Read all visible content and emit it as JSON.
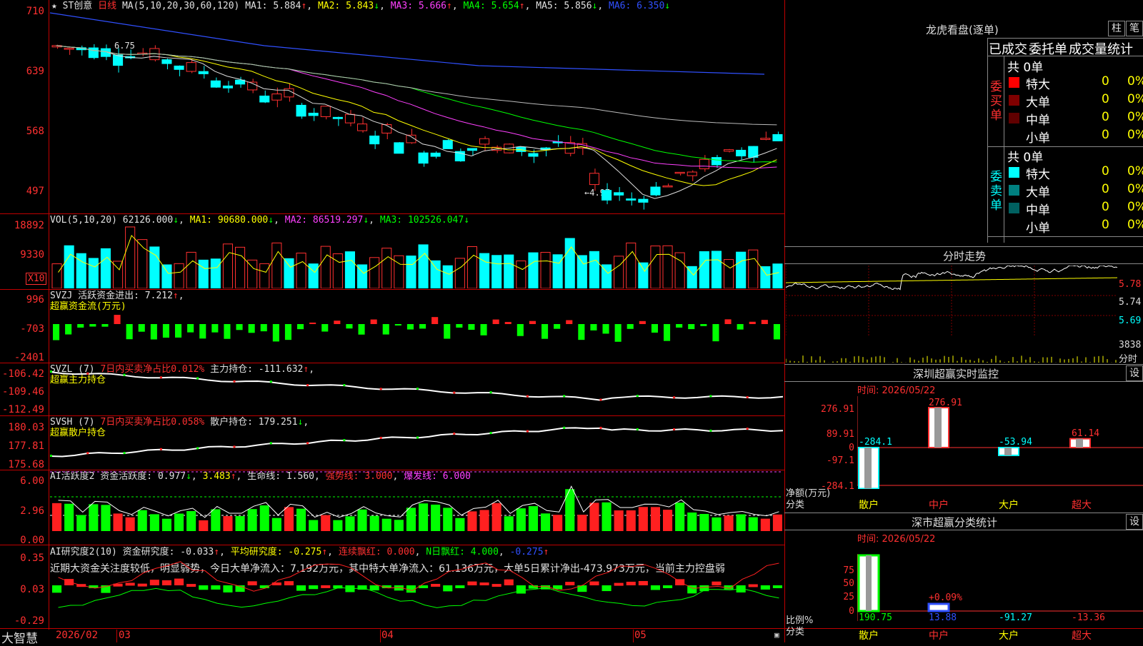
{
  "main_chart": {
    "star": "★",
    "name": "ST创意",
    "period": "日线",
    "ma_label": "MA(5,10,20,30,60,120)",
    "ma": [
      {
        "label": "MA1:",
        "value": "5.884",
        "arrow": "↑",
        "color": "#e0e0e0"
      },
      {
        "label": "MA2:",
        "value": "5.843",
        "arrow": "↓",
        "color": "#ffff00"
      },
      {
        "label": "MA3:",
        "value": "5.666",
        "arrow": "↑",
        "color": "#ff40ff"
      },
      {
        "label": "MA4:",
        "value": "5.654",
        "arrow": "↑",
        "color": "#00ff00"
      },
      {
        "label": "MA5:",
        "value": "5.856",
        "arrow": "↓",
        "color": "#e0e0e0"
      },
      {
        "label": "MA6:",
        "value": "6.350",
        "arrow": "↓",
        "color": "#3050ff"
      }
    ],
    "y_ticks": [
      "710",
      "639",
      "568",
      "497"
    ],
    "high_label": "6.75",
    "low_label": "←4.97"
  },
  "vol": {
    "label": "VOL(5,10,20)",
    "value": "62126.000",
    "ma1": "MA1: 90680.000",
    "ma2": "MA2: 86519.297",
    "ma3": "MA3: 102526.047",
    "y_ticks": [
      "18892",
      "9330"
    ],
    "unit": "X10"
  },
  "svzj": {
    "line1": "SVZJ  活跃资金进出: 7.212",
    "line2": "超赢资金流(万元)",
    "y_ticks": [
      "996",
      "-703",
      "-2401"
    ]
  },
  "svzl": {
    "pre": "SVZL (7)",
    "mid": "7日内买卖净占比0.012%",
    "post": "主力持仓: -111.632",
    "line2": "超赢主力持仓",
    "y_ticks": [
      "-106.42",
      "-109.46",
      "-112.49"
    ]
  },
  "svsh": {
    "pre": "SVSH (7)",
    "mid": "7日内买卖净占比0.058%",
    "post": "散户持仓: 179.251",
    "line2": "超赢散户持仓",
    "y_ticks": [
      "180.03",
      "177.81",
      "175.68"
    ]
  },
  "ai_active": {
    "pre": "AI活跃度2 资金活跃度: 0.977",
    "v2": "3.483",
    "v3": "生命线: 1.560",
    "v4": "强势线: 3.000",
    "v5": "爆发线: 6.000",
    "y_ticks": [
      "6.00",
      "2.96",
      "0.00"
    ]
  },
  "ai_research": {
    "pre": "AI研究度2(10) 资金研究度: -0.033",
    "v2": "平均研究度: -0.275",
    "v3": "连续飘红: 0.000",
    "v4": "N日飘红: 4.000",
    "v5": "-0.275",
    "comment": "近期大资金关注度较低，明显弱势，今日大单净流入：7.192万元，其中特大单净流入：61.136万元，大单5日累计净出-473.973万元，当前主力控盘弱",
    "y_ticks": [
      "0.35",
      "0.03",
      "-0.29"
    ]
  },
  "bottom_bar": {
    "brand": "大智慧",
    "dates": [
      "2026/02",
      "03",
      "04",
      "05"
    ]
  },
  "right": {
    "lhb_title": "龙虎看盘(逐单)",
    "btn_zhu": "柱",
    "btn_bi": "笔",
    "tabs": [
      "已成交",
      "委托单",
      "成交量统计"
    ],
    "buy": {
      "side_label": "委买单",
      "total": "共 0单",
      "rows": [
        {
          "name": "特大",
          "count": "0",
          "pct": "0%",
          "color": "#ff0000"
        },
        {
          "name": "大单",
          "count": "0",
          "pct": "0%",
          "color": "#800000"
        },
        {
          "name": "中单",
          "count": "0",
          "pct": "0%",
          "color": "#600000"
        },
        {
          "name": "小单",
          "count": "0",
          "pct": "0%",
          "color": "#000000"
        }
      ]
    },
    "sell": {
      "side_label": "委卖单",
      "total": "共 0单",
      "rows": [
        {
          "name": "特大",
          "count": "0",
          "pct": "0%",
          "color": "#00ffff"
        },
        {
          "name": "大单",
          "count": "0",
          "pct": "0%",
          "color": "#008080"
        },
        {
          "name": "中单",
          "count": "0",
          "pct": "0%",
          "color": "#006060"
        },
        {
          "name": "小单",
          "count": "0",
          "pct": "0%",
          "color": "#000000"
        }
      ]
    },
    "intraday_title": "分时走势",
    "intraday_ticks": [
      "5.78",
      "5.74",
      "5.69",
      "3838",
      "分时"
    ],
    "sz_title": "深圳超赢实时监控",
    "sz_time": "时间: 2026/05/22",
    "set": "设",
    "sz_yticks": [
      "276.91",
      "89.91",
      "0",
      "-97.1",
      "-284.1"
    ],
    "sz_vals": [
      "-284.1",
      "276.91",
      "-53.94",
      "61.14"
    ],
    "sz_unit": "净额(万元)",
    "sz_cat": "分类",
    "cats": [
      "散户",
      "中户",
      "大户",
      "超大"
    ],
    "cls_title": "深市超赢分类统计",
    "cls_time": "时间: 2026/05/22",
    "cls_yticks": [
      "75",
      "50",
      "25",
      "0"
    ],
    "cls_pct": "+0.09%",
    "cls_vals": [
      "190.75",
      "13.88",
      "-91.27",
      "-13.36"
    ],
    "cls_unit": "比例%",
    "cls_cat": "分类"
  }
}
